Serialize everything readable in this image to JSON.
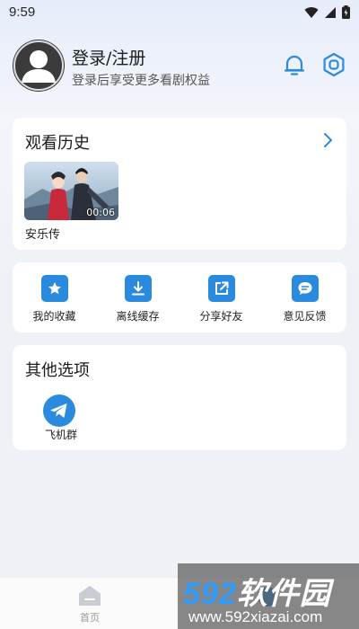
{
  "status_bar": {
    "time": "9:59"
  },
  "header": {
    "login_title": "登录/注册",
    "login_subtitle": "登录后享受更多看剧权益",
    "icons": [
      "bell-icon",
      "settings-icon"
    ]
  },
  "history": {
    "title": "观看历史",
    "items": [
      {
        "title": "安乐传",
        "duration": "00:06"
      }
    ]
  },
  "actions": [
    {
      "label": "我的收藏",
      "icon": "star-icon"
    },
    {
      "label": "离线缓存",
      "icon": "download-icon"
    },
    {
      "label": "分享好友",
      "icon": "share-icon"
    },
    {
      "label": "意见反馈",
      "icon": "feedback-icon"
    }
  ],
  "other": {
    "title": "其他选项",
    "items": [
      {
        "label": "飞机群",
        "icon": "telegram-icon"
      }
    ]
  },
  "bottom_nav": {
    "home_label": "首页"
  },
  "watermark": {
    "logo_number": "592",
    "logo_text": "软件园",
    "url": "www.592xiazai.com"
  },
  "colors": {
    "accent": "#2a8bde",
    "background": "#eef1f6",
    "card": "#ffffff"
  }
}
